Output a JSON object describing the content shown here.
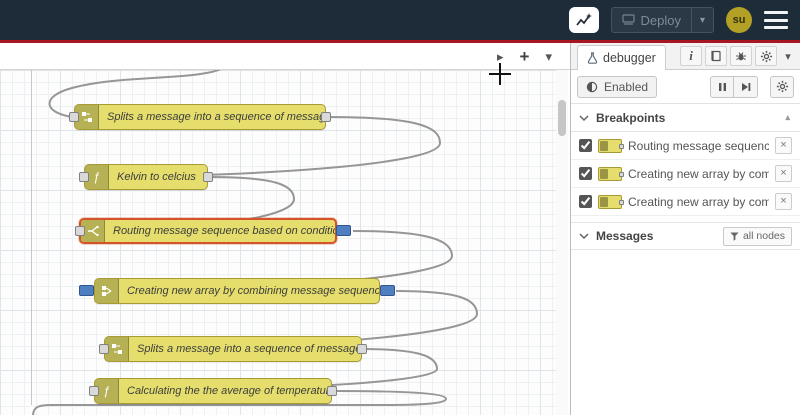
{
  "header": {
    "deploy_label": "Deploy",
    "avatar_initials": "su",
    "colors": {
      "header_bg": "#1e2c39",
      "alert_bar": "#aa1522",
      "avatar_bg": "#b3a125"
    }
  },
  "canvas_toolbar": {
    "play_glyph": "▸",
    "add_glyph": "+",
    "menu_glyph": "▾"
  },
  "canvas": {
    "nodes": [
      {
        "label": "Splits a message into a sequence of messages.",
        "icon": "split-icon"
      },
      {
        "label": "Kelvin to celcius",
        "icon": "function-icon"
      },
      {
        "label": "Routing message sequence based on condition",
        "icon": "switch-icon",
        "selected": true,
        "breakpoint_out": true
      },
      {
        "label": "Creating new array by combining message sequence",
        "icon": "join-icon",
        "breakpoint_in": true,
        "breakpoint_out": true
      },
      {
        "label": "Splits a message into a sequence of messages.",
        "icon": "split-icon"
      },
      {
        "label": "Calculating the the average of temperature",
        "icon": "function-icon"
      }
    ],
    "colors": {
      "node_bg": "#e5de6d",
      "node_border": "#a79a35",
      "wire": "#999999",
      "breakpoint_blue": "#4e7fc1",
      "selected_outline": "#d4542a"
    }
  },
  "sidebar": {
    "tab_label": "debugger",
    "toolbar": {
      "enabled_label": "Enabled"
    },
    "breakpoints": {
      "title": "Breakpoints",
      "items": [
        {
          "label": "Routing message sequence ba",
          "checked": true
        },
        {
          "label": "Creating new array by combini",
          "checked": true
        },
        {
          "label": "Creating new array by combini",
          "checked": true
        }
      ]
    },
    "messages": {
      "title": "Messages",
      "filter_label": "all nodes"
    }
  },
  "icons": {
    "close": "×",
    "caret_down": "▾",
    "caret_up": "▴",
    "info": "i",
    "function_glyph": "ƒ"
  }
}
